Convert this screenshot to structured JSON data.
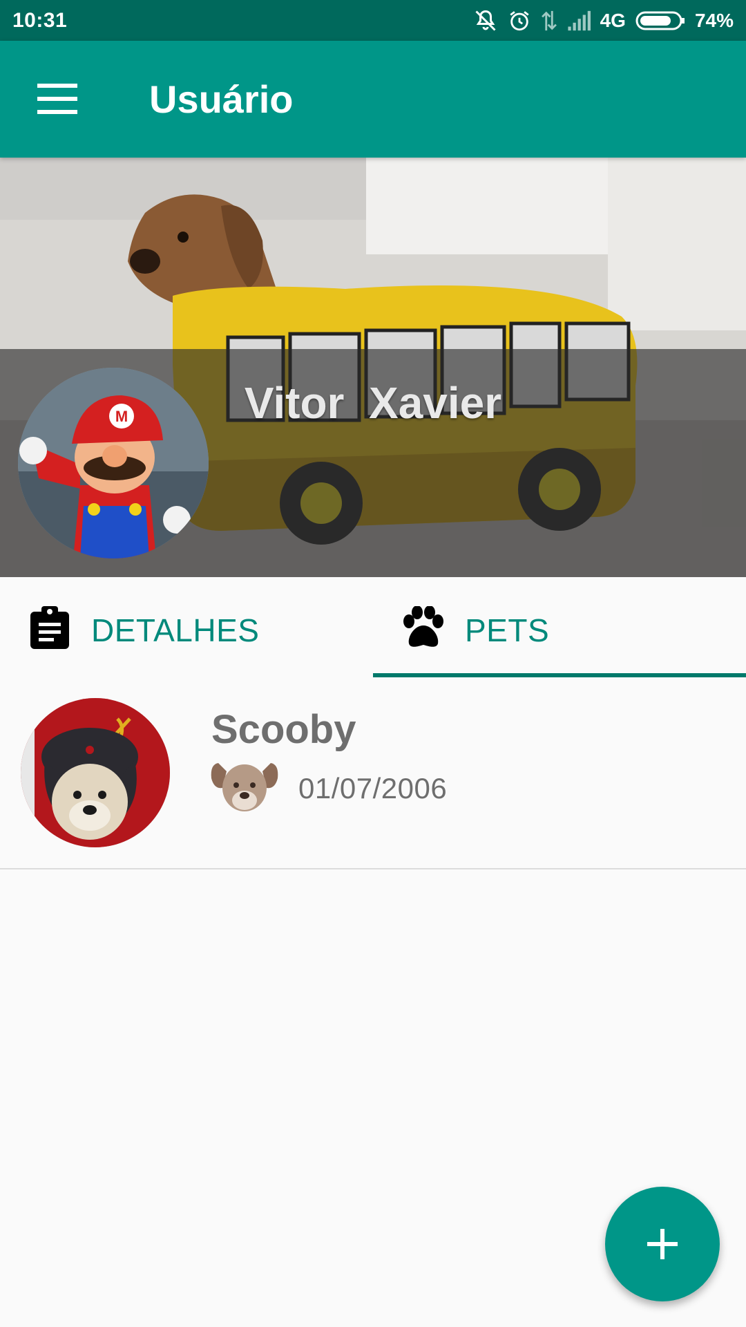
{
  "status_bar": {
    "time": "10:31",
    "network": "4G",
    "battery": "74%",
    "icons": [
      "silent-icon",
      "alarm-icon",
      "data-arrows-icon",
      "signal-icon",
      "battery-icon"
    ]
  },
  "app_bar": {
    "title": "Usuário",
    "menu_icon": "hamburger-menu-icon",
    "color": "#009688"
  },
  "profile": {
    "name": "Vitor  Xavier",
    "avatar": "user-avatar",
    "cover": "cover-photo"
  },
  "tabs": [
    {
      "label": "DETALHES",
      "icon": "clipboard-icon",
      "selected": false
    },
    {
      "label": "PETS",
      "icon": "paw-icon",
      "selected": true
    }
  ],
  "pets": [
    {
      "name": "Scooby",
      "date": "01/07/2006",
      "species_icon": "dog-icon"
    }
  ],
  "fab": {
    "icon": "plus-icon",
    "color": "#009688"
  },
  "colors": {
    "primary": "#009688",
    "primary_dark": "#00695c",
    "accent_text": "#00897b"
  }
}
